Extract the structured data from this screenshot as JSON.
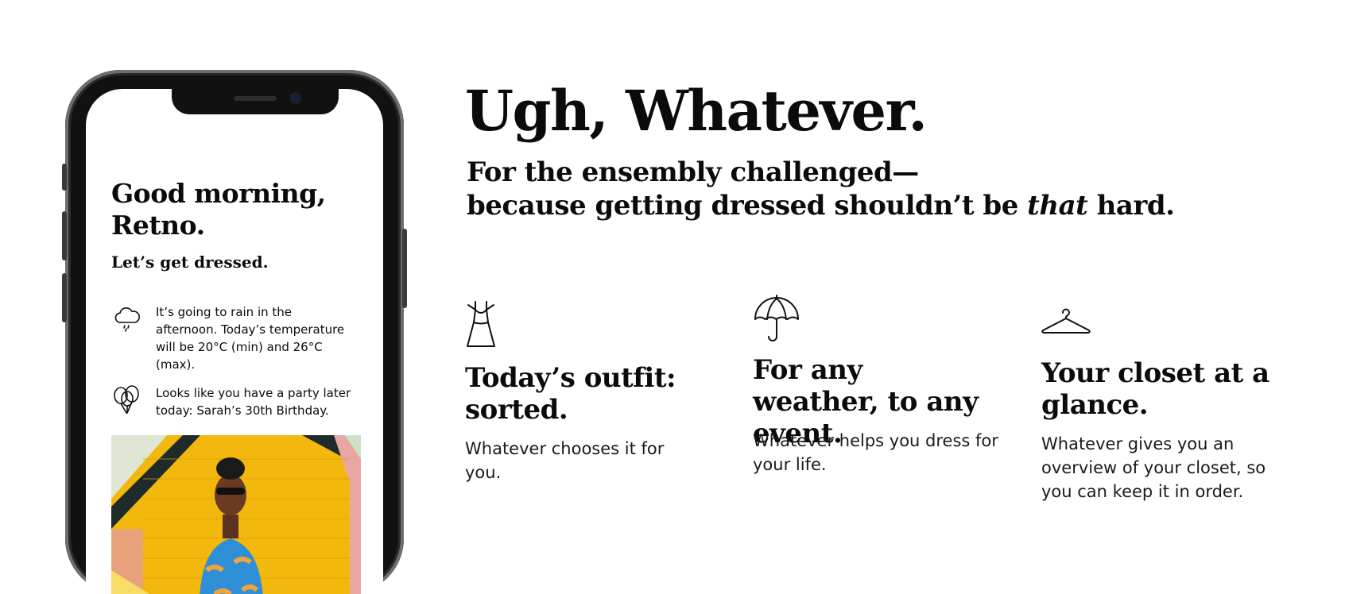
{
  "phone": {
    "greeting": "Good morning, Retno.",
    "subgreeting": "Let’s get dressed.",
    "notices": [
      {
        "icon": "rain-cloud-icon",
        "text": "It’s going to rain in the afternoon. Today’s temperature will be 20°C (min) and 26°C (max)."
      },
      {
        "icon": "balloons-icon",
        "text": "Looks like you have a party later today: Sarah’s 30th Birthday."
      }
    ]
  },
  "hero": {
    "headline": "Ugh, Whatever.",
    "tagline_line1": "For the ensembly challenged—",
    "tagline_line2_before": "because getting dressed shouldn’t be ",
    "tagline_line2_em": "that",
    "tagline_line2_after": " hard."
  },
  "features": [
    {
      "icon": "dress-icon",
      "title": "Today’s outfit: sorted.",
      "text": "Whatever chooses it for you."
    },
    {
      "icon": "umbrella-icon",
      "title": "For any weather, to any event.",
      "text": "Whatever helps you dress for your life."
    },
    {
      "icon": "hanger-icon",
      "title": "Your closet at a glance.",
      "text": "Whatever gives you an overview of your closet, so you can keep it in order."
    }
  ]
}
